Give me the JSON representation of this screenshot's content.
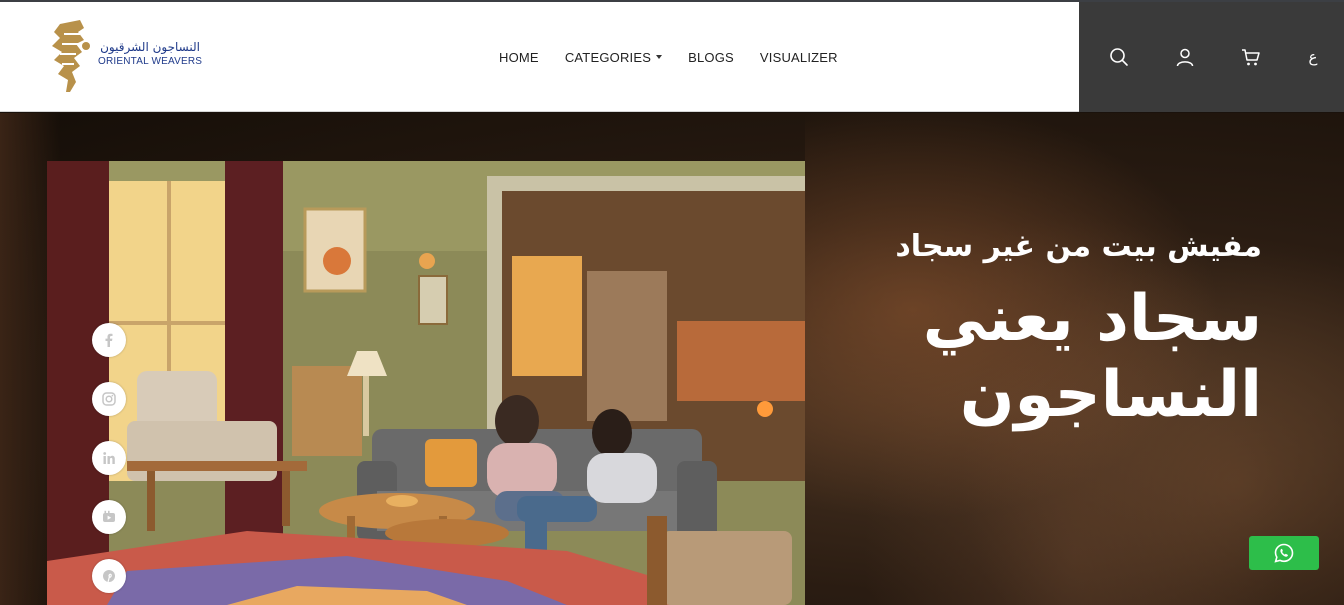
{
  "brand": {
    "name_ar": "النساجون الشرقيون",
    "name_en": "ORIENTAL WEAVERS",
    "logo_color": "#b8914a",
    "text_color": "#1f3a8a"
  },
  "nav": {
    "items": [
      {
        "label": "HOME"
      },
      {
        "label": "CATEGORIES",
        "has_dropdown": true
      },
      {
        "label": "BLOGS"
      },
      {
        "label": "VISUALIZER"
      }
    ]
  },
  "utility": {
    "icons": [
      "search-icon",
      "user-icon",
      "cart-icon"
    ],
    "language_label": "ع",
    "background": "#3a3a3a"
  },
  "hero": {
    "tagline": "مفيش بيت من غير سجاد",
    "headline_line1": "سجاد يعني",
    "headline_line2": "النساجون"
  },
  "social": {
    "icons": [
      "facebook-icon",
      "instagram-icon",
      "linkedin-icon",
      "youtube-icon",
      "pinterest-icon"
    ]
  },
  "whatsapp": {
    "icon": "whatsapp-icon",
    "color": "#2dbe4a"
  }
}
